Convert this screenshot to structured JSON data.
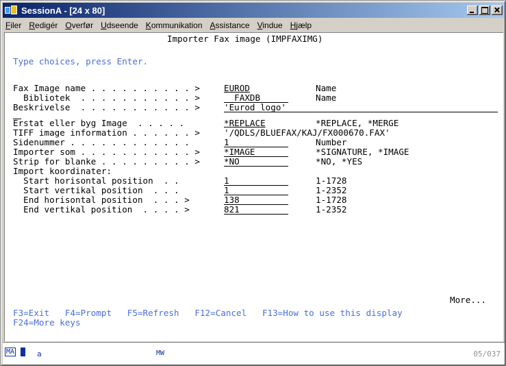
{
  "window": {
    "title": "SessionA - [24 x 80]"
  },
  "menubar": {
    "items": [
      {
        "first": "F",
        "rest": "iler"
      },
      {
        "first": "R",
        "rest": "edigér"
      },
      {
        "first": "O",
        "rest": "verfør"
      },
      {
        "first": "U",
        "rest": "dseende"
      },
      {
        "first": "K",
        "rest": "ommunikation"
      },
      {
        "first": "A",
        "rest": "ssistance"
      },
      {
        "first": "V",
        "rest": "indue"
      },
      {
        "first": "H",
        "rest": "jælp"
      }
    ]
  },
  "screen": {
    "title": "Importer Fax image (IMPFAXIMG)",
    "instruction": "Type choices, press Enter.",
    "fields": {
      "fax_image_name": {
        "label": "Fax Image name . . . . . . . . . . >",
        "value": "EUROD",
        "hint": "Name"
      },
      "bibliotek": {
        "label": "  Bibliotek  . . . . . . . . . . . >",
        "value": "  FAXDB",
        "hint": "Name"
      },
      "beskrivelse": {
        "label": "Beskrivelse  . . . . . . . . . . . >",
        "value": "'Eurod logo'"
      },
      "erstat": {
        "label": "Erstat eller byg Image  . . . . .",
        "value": "*REPLACE",
        "hint": "*REPLACE, *MERGE"
      },
      "tiff_info": {
        "label": "TIFF image information . . . . . . >",
        "value": "'/QDLS/BLUEFAX/KAJ/FX000670.FAX'"
      },
      "sidenummer": {
        "label": "Sidenummer . . . . . . . . . . . .",
        "value": "1",
        "hint": "Number"
      },
      "importer_som": {
        "label": "Importer som . . . . . . . . . . . >",
        "value": "*IMAGE",
        "hint": "*SIGNATURE, *IMAGE"
      },
      "strip_blanke": {
        "label": "Strip for blanke . . . . . . . . . >",
        "value": "*NO",
        "hint": "*NO, *YES"
      },
      "import_koordinater": {
        "label": "Import koordinater:"
      },
      "start_h": {
        "label": "  Start horisontal position  . .",
        "value": "1",
        "hint": "1-1728"
      },
      "start_v": {
        "label": "  Start vertikal position  . . .",
        "value": "1",
        "hint": "1-2352"
      },
      "end_h": {
        "label": "  End horisontal position  . . . >",
        "value": "138",
        "hint": "1-1728"
      },
      "end_v": {
        "label": "  End vertikal position  . . . . >",
        "value": "821",
        "hint": "1-2352"
      }
    },
    "more": "More...",
    "fkeys_line1": "F3=Exit   F4=Prompt   F5=Refresh   F12=Cancel   F13=How to use this display",
    "fkeys_line2": "F24=More keys"
  },
  "status": {
    "mode": "MA",
    "input": "a",
    "indicator": "MW",
    "cursor": "05/037"
  },
  "colors": {
    "titlebar_start": "#0a246a",
    "titlebar_end": "#a6caf0",
    "screen_bg": "#ffffff",
    "help_text": "#4a6fd8",
    "status_text": "#1030a0"
  }
}
